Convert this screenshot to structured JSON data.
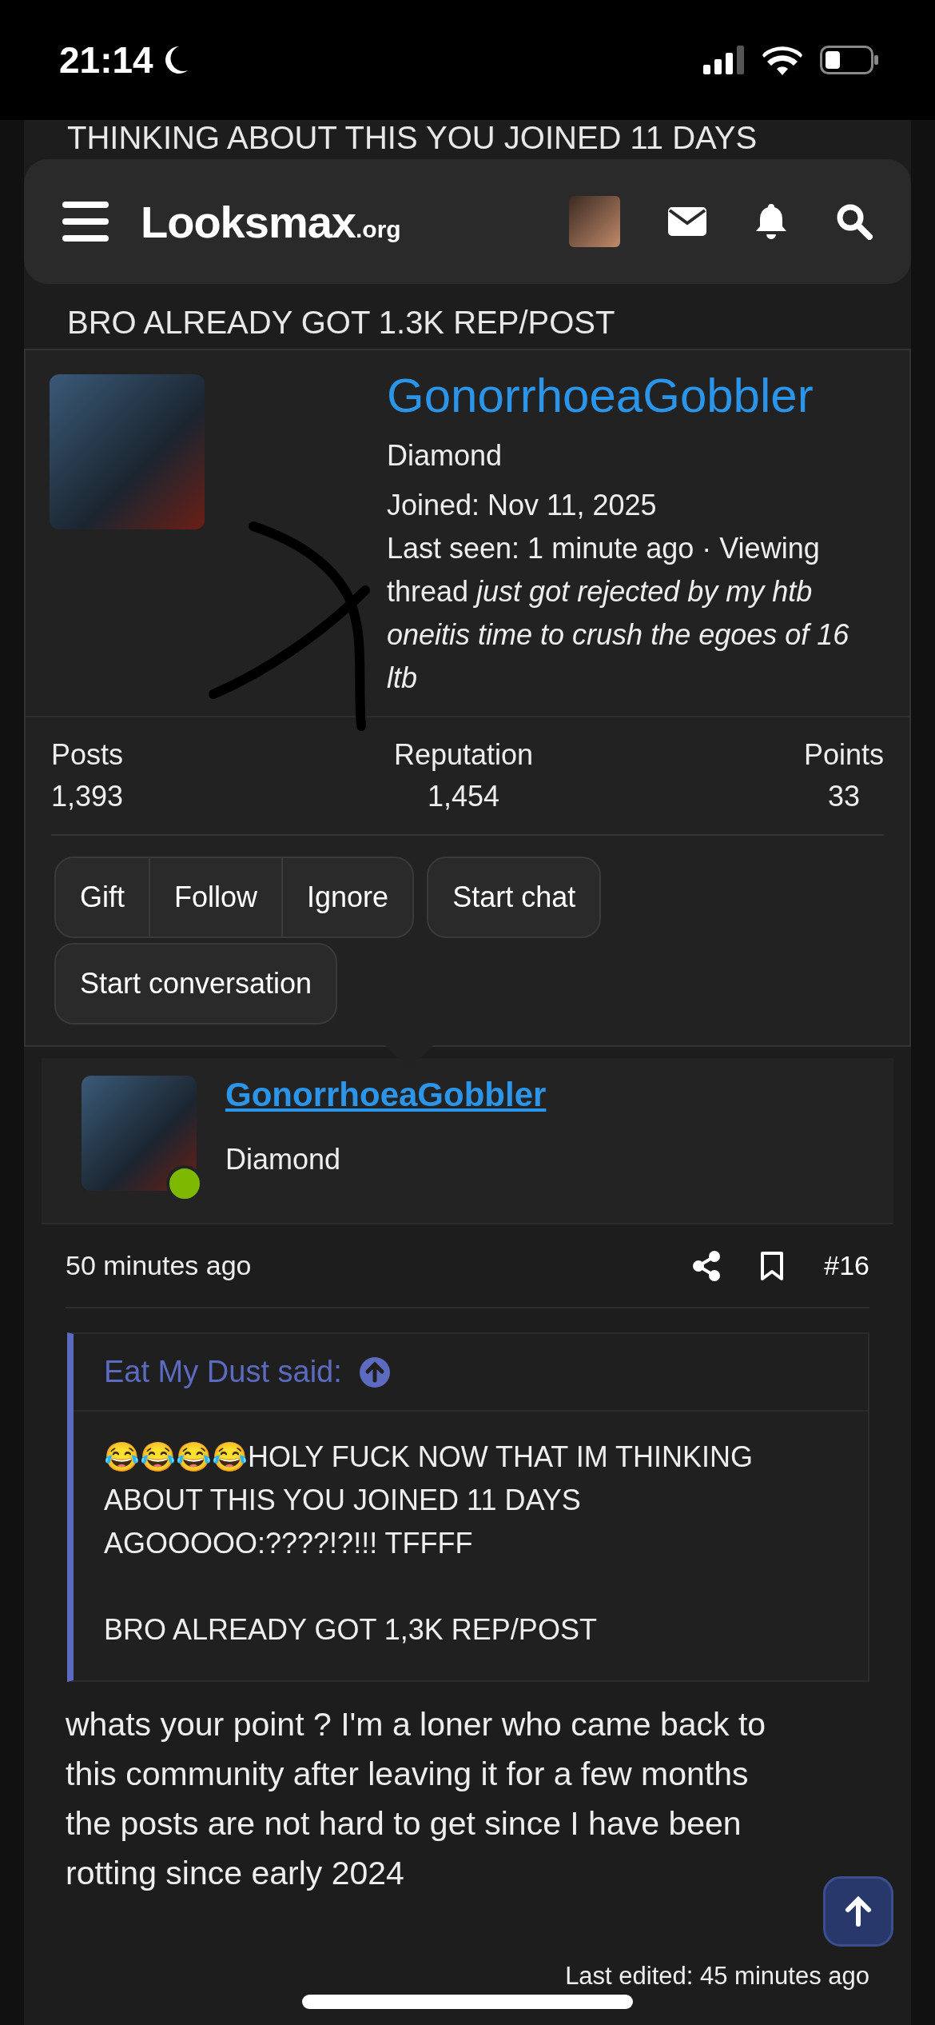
{
  "status_bar": {
    "time": "21:14"
  },
  "behind_header_text": "THINKING ABOUT THIS YOU JOINED 11 DAYS",
  "header": {
    "logo": "Looksmax",
    "logo_suffix": ".org"
  },
  "behind_text": "BRO ALREADY GOT 1.3K REP/POST",
  "profile_card": {
    "name": "GonorrhoeaGobbler",
    "rank": "Diamond",
    "joined": "Joined: Nov 11, 2025",
    "last_seen": "Last seen: 1 minute ago · Viewing thread",
    "activity": "just got rejected by my htb oneitis time to crush the egoes of 16 ltb",
    "stats": [
      {
        "label": "Posts",
        "value": "1,393"
      },
      {
        "label": "Reputation",
        "value": "1,454"
      },
      {
        "label": "Points",
        "value": "33"
      }
    ],
    "button_groups": [
      [
        "Gift",
        "Follow",
        "Ignore"
      ],
      [
        "Start chat"
      ],
      [
        "Start conversation"
      ]
    ]
  },
  "post": {
    "author": "GonorrhoeaGobbler",
    "rank": "Diamond",
    "online": true,
    "time": "50 minutes ago",
    "number": "#16",
    "quote": {
      "author": "Eat My Dust said:",
      "paragraphs": [
        "😂😂😂😂HOLY FUCK NOW THAT IM THINKING ABOUT THIS YOU JOINED 11 DAYS AGOOOOO:????!?!!! TFFFF",
        "BRO ALREADY GOT 1,3K REP/POST"
      ]
    },
    "body": "whats your point ? I'm a loner who came back to this community after leaving it for a few months the posts are not hard to get since I have been rotting since early 2024",
    "last_edited": "Last edited: 45 minutes ago"
  }
}
